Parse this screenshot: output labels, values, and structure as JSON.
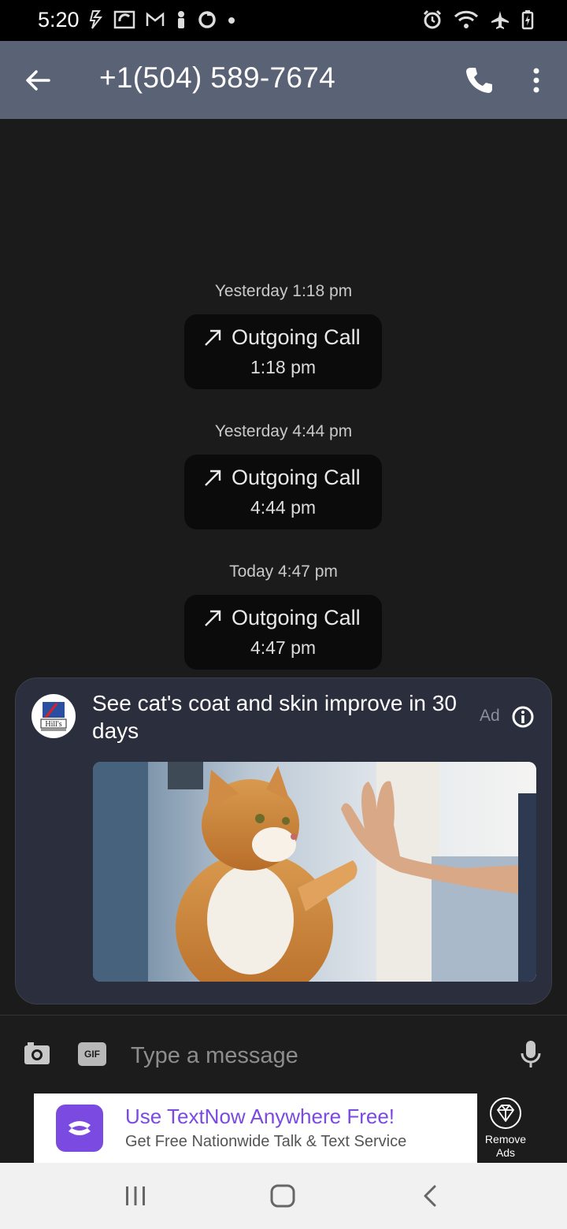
{
  "status_bar": {
    "time": "5:20",
    "left_icons": [
      "data-saver-icon",
      "signal-app-icon",
      "gmail-icon",
      "person-icon",
      "sync-icon",
      "dot-icon"
    ],
    "right_icons": [
      "alarm-icon",
      "wifi-icon",
      "airplane-icon",
      "battery-charging-icon"
    ]
  },
  "app_bar": {
    "title": "+1(504) 589-7674",
    "back_icon": "arrow-left-icon",
    "call_icon": "phone-icon",
    "more_icon": "more-vert-icon",
    "background": "#5a6275"
  },
  "messages": [
    {
      "timestamp": "Yesterday 1:18 pm",
      "label": "Outgoing Call",
      "time": "1:18 pm"
    },
    {
      "timestamp": "Yesterday 4:44 pm",
      "label": "Outgoing Call",
      "time": "4:44 pm"
    },
    {
      "timestamp": "Today 4:47 pm",
      "label": "Outgoing Call",
      "time": "4:47 pm"
    }
  ],
  "ad": {
    "logo_text": "Hill's",
    "headline": "See cat's coat and skin improve in 30 days",
    "label": "Ad",
    "info_icon": "info-icon",
    "image": "cat-high-five-image"
  },
  "composer": {
    "camera_icon": "camera-icon",
    "gif_label": "GIF",
    "placeholder": "Type a message",
    "value": "",
    "mic_icon": "mic-icon"
  },
  "banner": {
    "title": "Use TextNow Anywhere Free!",
    "subtitle": "Get Free Nationwide Talk & Text Service",
    "remove_ads_label": "Remove Ads",
    "accent": "#7b4ae0"
  },
  "nav_bar": {
    "icons": [
      "recents-icon",
      "home-icon",
      "back-icon"
    ]
  }
}
